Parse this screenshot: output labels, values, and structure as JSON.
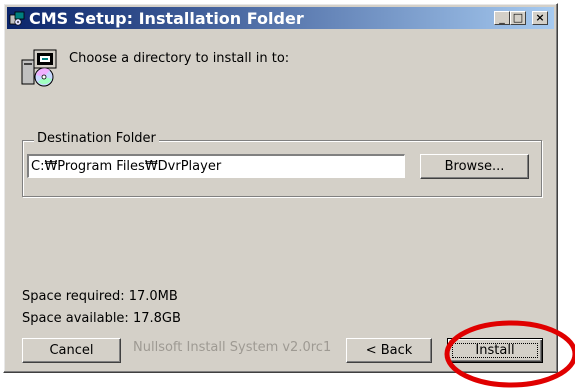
{
  "window": {
    "title": "CMS Setup: Installation Folder",
    "controls": {
      "minimize": "_",
      "maximize": "□",
      "close": "×"
    }
  },
  "header": {
    "text": "Choose a directory to install in to:",
    "icon": "installer-icon"
  },
  "destination": {
    "group_label": "Destination Folder",
    "path": "C:₩Program Files₩DvrPlayer",
    "browse_label": "Browse..."
  },
  "space": {
    "required": "Space required: 17.0MB",
    "available": "Space available: 17.8GB"
  },
  "footer": {
    "cancel_label": "Cancel",
    "branding": "Nullsoft Install System v2.0rc1",
    "back_label": "< Back",
    "install_label": "Install"
  },
  "colors": {
    "titlebar_start": "#0a246a",
    "titlebar_end": "#a6caf0",
    "window_face": "#d4d0c8",
    "annotation": "#e00000"
  }
}
